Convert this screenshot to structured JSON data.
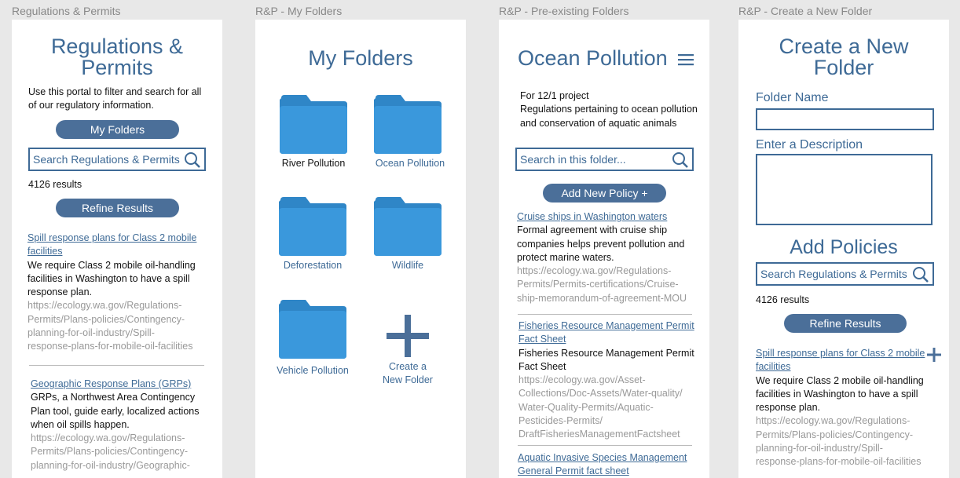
{
  "frames": {
    "f1": {
      "label": "Regulations & Permits",
      "title_line1": "Regulations &",
      "title_line2": "Permits",
      "intro_line1": "Use this portal to filter and search for all",
      "intro_line2": "of our regulatory information.",
      "my_folders_button": "My Folders",
      "search_placeholder": "Search Regulations & Permits",
      "results_count": "4126 results",
      "refine_button": "Refine Results",
      "results": [
        {
          "title_lines": [
            "Spill response plans for Class 2 mobile",
            "facilities"
          ],
          "desc_lines": [
            "We require Class 2 mobile oil-handling",
            "facilities in Washington to have a spill",
            "response plan."
          ],
          "url_lines": [
            "https://ecology.wa.gov/Regulations-",
            "Permits/Plans-policies/Contingency-",
            "planning-for-oil-industry/Spill-",
            "response-plans-for-mobile-oil-facilities"
          ]
        },
        {
          "title_lines": [
            "Geographic Response Plans (GRPs)"
          ],
          "desc_lines": [
            "GRPs, a Northwest Area Contingency",
            "Plan tool, guide early, localized actions",
            "when oil spills happen."
          ],
          "url_lines": [
            "https://ecology.wa.gov/Regulations-",
            "Permits/Plans-policies/Contingency-",
            "planning-for-oil-industry/Geographic-"
          ]
        }
      ]
    },
    "f2": {
      "label": "R&P - My Folders",
      "title": "My Folders",
      "folders": [
        "River Pollution",
        "Ocean Pollution",
        "Deforestation",
        "Wildlife",
        "Vehicle Pollution"
      ],
      "create_line1": "Create a",
      "create_line2": "New Folder",
      "folder_color": "#3a98dc",
      "folder_tab_color": "#2f86c7"
    },
    "f3": {
      "label": "R&P - Pre-existing Folders",
      "title": "Ocean Pollution",
      "desc_line1": "For 12/1 project",
      "desc_line2": "Regulations pertaining to ocean pollution",
      "desc_line3": "and conservation of aquatic animals",
      "search_placeholder": "Search in this folder...",
      "add_button": "Add New Policy +",
      "results": [
        {
          "title_lines": [
            "Cruise ships in Washington waters"
          ],
          "desc_lines": [
            "Formal agreement with cruise ship",
            "companies helps prevent pollution and",
            "protect marine waters."
          ],
          "url_lines": [
            "https://ecology.wa.gov/Regulations-",
            "Permits/Permits-certifications/Cruise-",
            "ship-memorandum-of-agreement-MOU"
          ]
        },
        {
          "title_lines": [
            "Fisheries Resource Management Permit",
            "Fact Sheet"
          ],
          "desc_lines": [
            "Fisheries Resource Management Permit",
            "Fact Sheet"
          ],
          "url_lines": [
            "https://ecology.wa.gov/Asset-",
            "Collections/Doc-Assets/Water-quality/",
            "Water-Quality-Permits/Aquatic-",
            "Pesticides-Permits/",
            "DraftFisheriesManagementFactsheet"
          ]
        },
        {
          "title_lines": [
            "Aquatic Invasive Species Management",
            "General Permit fact sheet"
          ],
          "desc_lines": [],
          "url_lines": []
        }
      ]
    },
    "f4": {
      "label": "R&P - Create a New Folder",
      "title_line1": "Create a New",
      "title_line2": "Folder",
      "folder_name_label": "Folder Name",
      "description_label": "Enter a Description",
      "add_policies_title": "Add Policies",
      "search_placeholder": "Search Regulations & Permits",
      "results_count": "4126 results",
      "refine_button": "Refine Results",
      "result": {
        "title_lines": [
          "Spill response plans for Class 2 mobile",
          "facilities"
        ],
        "desc_lines": [
          "We require Class 2 mobile oil-handling",
          "facilities in Washington to have a spill",
          "response plan."
        ],
        "url_lines": [
          "https://ecology.wa.gov/Regulations-",
          "Permits/Plans-policies/Contingency-",
          "planning-for-oil-industry/Spill-",
          "response-plans-for-mobile-oil-facilities"
        ]
      }
    }
  }
}
